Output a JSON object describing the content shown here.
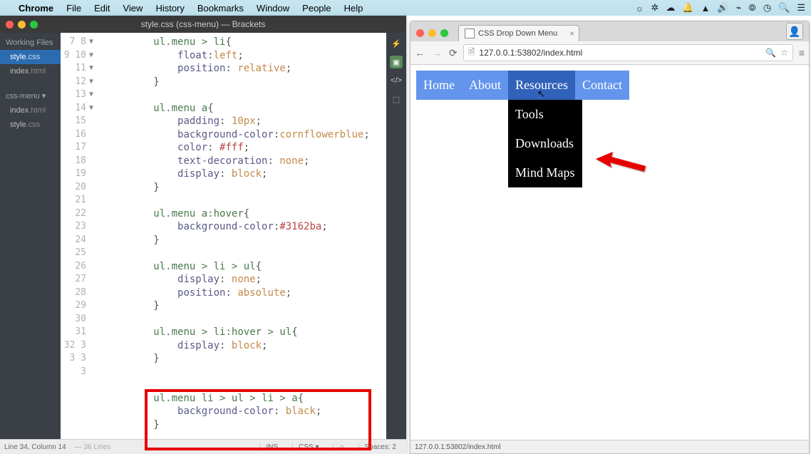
{
  "menubar": {
    "app": "Chrome",
    "items": [
      "File",
      "Edit",
      "View",
      "History",
      "Bookmarks",
      "Window",
      "People",
      "Help"
    ]
  },
  "brackets": {
    "title": "style.css (css-menu) — Brackets",
    "working_files_label": "Working Files",
    "project_label": "css-menu ▾",
    "working_files": [
      {
        "name": "style",
        "ext": ".css",
        "selected": true
      },
      {
        "name": "index",
        "ext": ".html",
        "selected": false
      }
    ],
    "project_files": [
      {
        "name": "index",
        "ext": ".html"
      },
      {
        "name": "style",
        "ext": ".css"
      }
    ],
    "line_numbers": [
      "7",
      "8",
      "9",
      "10",
      "11",
      "12",
      "13",
      "14",
      "15",
      "16",
      "17",
      "18",
      "19",
      "20",
      "21",
      "22",
      "23",
      "24",
      "25",
      "26",
      "27",
      "28",
      "29",
      "30",
      "31",
      "32",
      "3",
      "3",
      "3",
      "3"
    ],
    "fold_markers": [
      "▼",
      "",
      "",
      "",
      "",
      "▼",
      "",
      "",
      "",
      "",
      "",
      "",
      "",
      "▼",
      "",
      "",
      "",
      "▼",
      "",
      "",
      "",
      "",
      "▼",
      "",
      "",
      "",
      "",
      "▼",
      "",
      ""
    ],
    "code_html": [
      "<span class='tok-sel'>ul.menu</span> <span class='tok-sel'>&gt;</span> <span class='tok-sel'>li</span>{",
      "    <span class='tok-prop'>float</span>:<span class='tok-val'>left</span>;",
      "    <span class='tok-prop'>position</span>: <span class='tok-val'>relative</span>;",
      "}",
      "",
      "<span class='tok-sel'>ul.menu</span> <span class='tok-sel'>a</span>{",
      "    <span class='tok-prop'>padding</span>: <span class='tok-val'>10px</span>;",
      "    <span class='tok-prop'>background-color</span>:<span class='tok-val'>cornflowerblue</span>;",
      "    <span class='tok-prop'>color</span>: <span class='tok-col'>#fff</span>;",
      "    <span class='tok-prop'>text-decoration</span>: <span class='tok-val'>none</span>;",
      "    <span class='tok-prop'>display</span>: <span class='tok-val'>block</span>;",
      "}",
      "",
      "<span class='tok-sel'>ul.menu</span> <span class='tok-sel'>a:hover</span>{",
      "    <span class='tok-prop'>background-color</span>:<span class='tok-col'>#3162ba</span>;",
      "}",
      "",
      "<span class='tok-sel'>ul.menu</span> <span class='tok-sel'>&gt;</span> <span class='tok-sel'>li</span> <span class='tok-sel'>&gt;</span> <span class='tok-sel'>ul</span>{",
      "    <span class='tok-prop'>display</span>: <span class='tok-val'>none</span>;",
      "    <span class='tok-prop'>position</span>: <span class='tok-val'>absolute</span>;",
      "}",
      "",
      "<span class='tok-sel'>ul.menu</span> <span class='tok-sel'>&gt;</span> <span class='tok-sel'>li:hover</span> <span class='tok-sel'>&gt;</span> <span class='tok-sel'>ul</span>{",
      "    <span class='tok-prop'>display</span>: <span class='tok-val'>block</span>;",
      "}",
      "",
      "",
      "<span class='tok-sel'>ul.menu</span> <span class='tok-sel'>li</span> <span class='tok-sel'>&gt;</span> <span class='tok-sel'>ul</span> <span class='tok-sel'>&gt;</span> <span class='tok-sel'>li</span> <span class='tok-sel'>&gt;</span> <span class='tok-sel'>a</span>{",
      "    <span class='tok-prop'>background-color</span>: <span class='tok-val'>black</span>;",
      "}"
    ],
    "status": {
      "pos": "Line 34, Column 14",
      "lines": "— 36 Lines",
      "ins": "INS",
      "lang": "CSS ▾",
      "spaces": "Spaces: 2"
    }
  },
  "chrome": {
    "tab_title": "CSS Drop Down Menu",
    "url": "127.0.0.1:53802/index.html",
    "status": "127.0.0.1:53802/index.html",
    "nav": {
      "items": [
        {
          "label": "Home"
        },
        {
          "label": "About"
        },
        {
          "label": "Resources",
          "hover": true,
          "sub": [
            "Tools",
            "Downloads",
            "Mind Maps"
          ]
        },
        {
          "label": "Contact"
        }
      ]
    }
  }
}
